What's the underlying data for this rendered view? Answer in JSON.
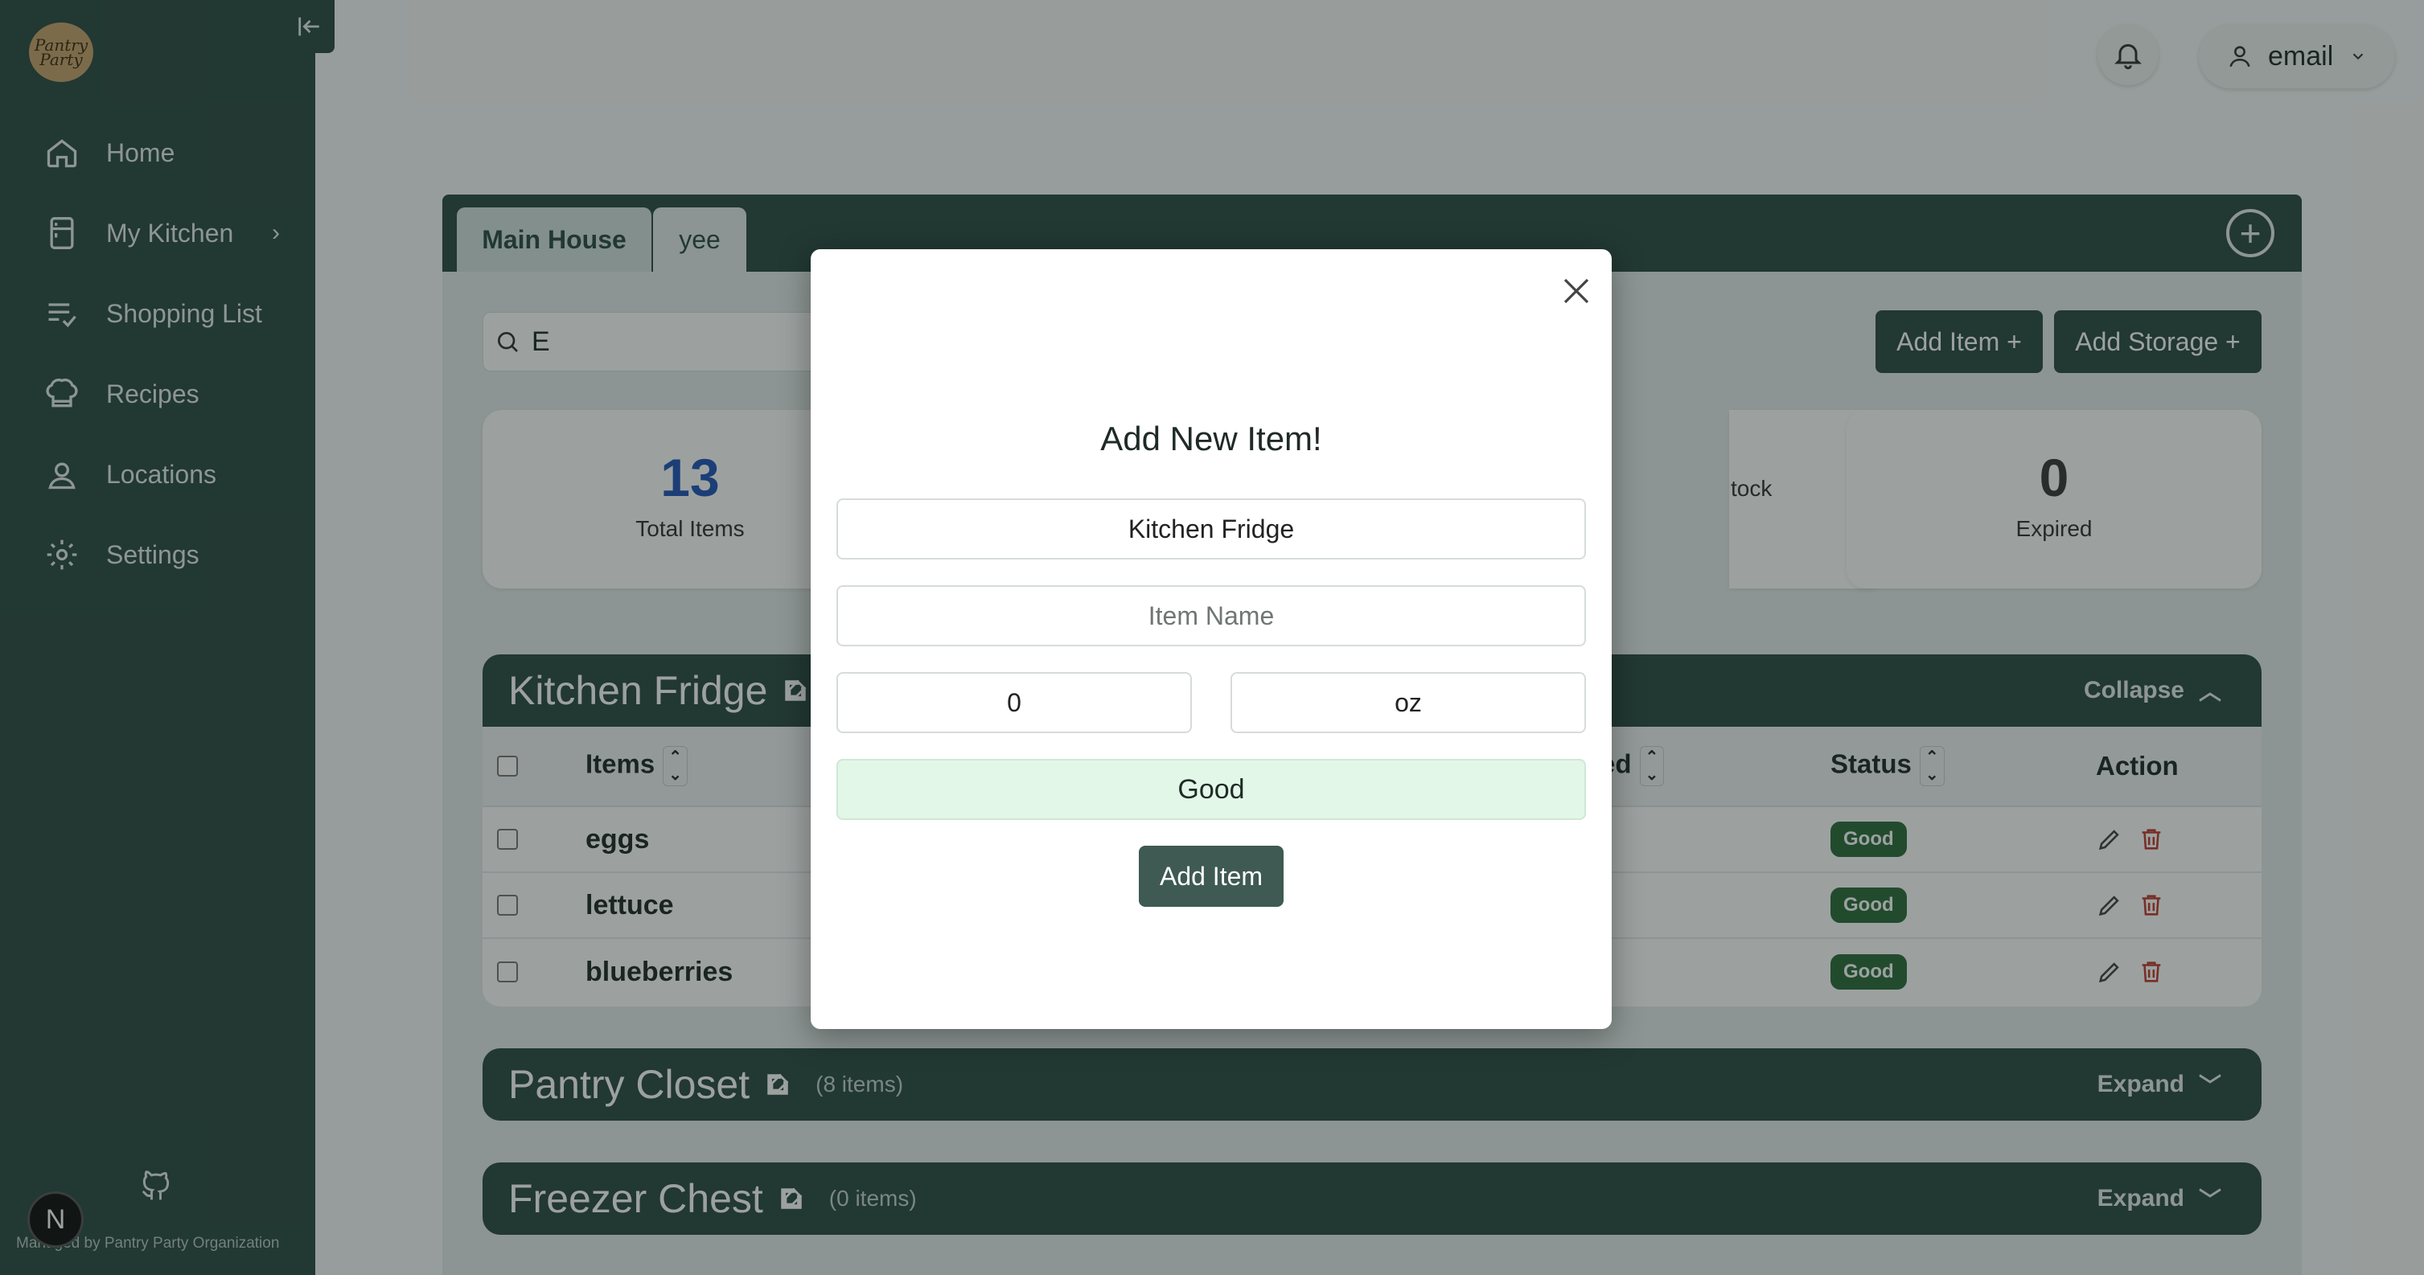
{
  "sidebar": {
    "logo_text": "Pantry Party",
    "items": [
      {
        "label": "Home",
        "icon": "home-icon"
      },
      {
        "label": "My Kitchen",
        "icon": "fridge-icon",
        "has_submenu": true
      },
      {
        "label": "Shopping List",
        "icon": "list-check-icon"
      },
      {
        "label": "Recipes",
        "icon": "chef-hat-icon"
      },
      {
        "label": "Locations",
        "icon": "location-user-icon"
      },
      {
        "label": "Settings",
        "icon": "gear-icon"
      }
    ],
    "footer": "Managed by Pantry Party Organization",
    "badge": "N"
  },
  "header": {
    "user_label": "email"
  },
  "main": {
    "tabs": [
      {
        "label": "Main House",
        "active": true
      },
      {
        "label": "yee",
        "active": false
      }
    ],
    "search_value": "E",
    "add_item_label": "Add Item +",
    "add_storage_label": "Add Storage +",
    "stats": [
      {
        "value": "13",
        "label": "Total Items",
        "color": "#2455b8"
      },
      {
        "value": "",
        "label": "tock",
        "color": "#333333"
      },
      {
        "value": "0",
        "label": "Expired",
        "color": "#3a3a3a"
      }
    ],
    "storages": [
      {
        "name": "Kitchen Fridge",
        "count": "",
        "toggle": "Collapse",
        "columns": {
          "items": "Items",
          "ed": "ed",
          "status": "Status",
          "action": "Action"
        },
        "rows": [
          {
            "item": "eggs",
            "status": "Good"
          },
          {
            "item": "lettuce",
            "status": "Good"
          },
          {
            "item": "blueberries",
            "status": "Good"
          }
        ]
      },
      {
        "name": "Pantry Closet",
        "count": "(8 items)",
        "toggle": "Expand"
      },
      {
        "name": "Freezer Chest",
        "count": "(0 items)",
        "toggle": "Expand"
      }
    ]
  },
  "modal": {
    "title": "Add New Item!",
    "storage_value": "Kitchen Fridge",
    "item_name_placeholder": "Item Name",
    "quantity_value": "0",
    "unit_value": "oz",
    "status_value": "Good",
    "submit_label": "Add Item"
  },
  "colors": {
    "primary": "#2e4a43",
    "good_pill": "#2e6b3c",
    "delete": "#c0392b"
  }
}
